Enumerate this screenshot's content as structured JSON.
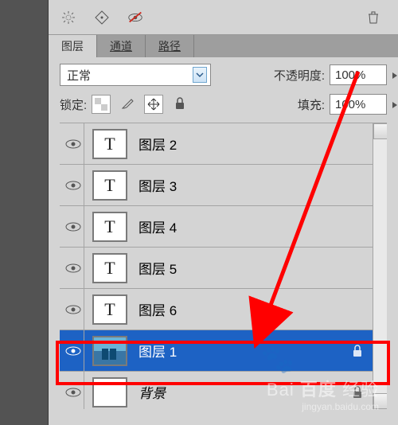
{
  "tabs": {
    "layers": "图层",
    "channels": "通道",
    "paths": "路径"
  },
  "blend": {
    "mode": "正常",
    "opacity_label": "不透明度:",
    "opacity_value": "100%",
    "lock_label": "锁定:",
    "fill_label": "填充:",
    "fill_value": "100%"
  },
  "layers": [
    {
      "name": "图层 2",
      "type": "text",
      "visible": true,
      "locked": false,
      "selected": false
    },
    {
      "name": "图层 3",
      "type": "text",
      "visible": true,
      "locked": false,
      "selected": false
    },
    {
      "name": "图层 4",
      "type": "text",
      "visible": true,
      "locked": false,
      "selected": false
    },
    {
      "name": "图层 5",
      "type": "text",
      "visible": true,
      "locked": false,
      "selected": false
    },
    {
      "name": "图层 6",
      "type": "text",
      "visible": true,
      "locked": false,
      "selected": false
    },
    {
      "name": "图层 1",
      "type": "image",
      "visible": true,
      "locked": true,
      "selected": true
    },
    {
      "name": "背景",
      "type": "bg",
      "visible": true,
      "locked": true,
      "selected": false
    }
  ],
  "thumb_letter": "T",
  "watermark": {
    "brand": "Bai",
    "brand2": "百度",
    "brand3": "经验",
    "url": "jingyan.baidu.com"
  },
  "annotations": {
    "highlight_layer_index": 5
  }
}
